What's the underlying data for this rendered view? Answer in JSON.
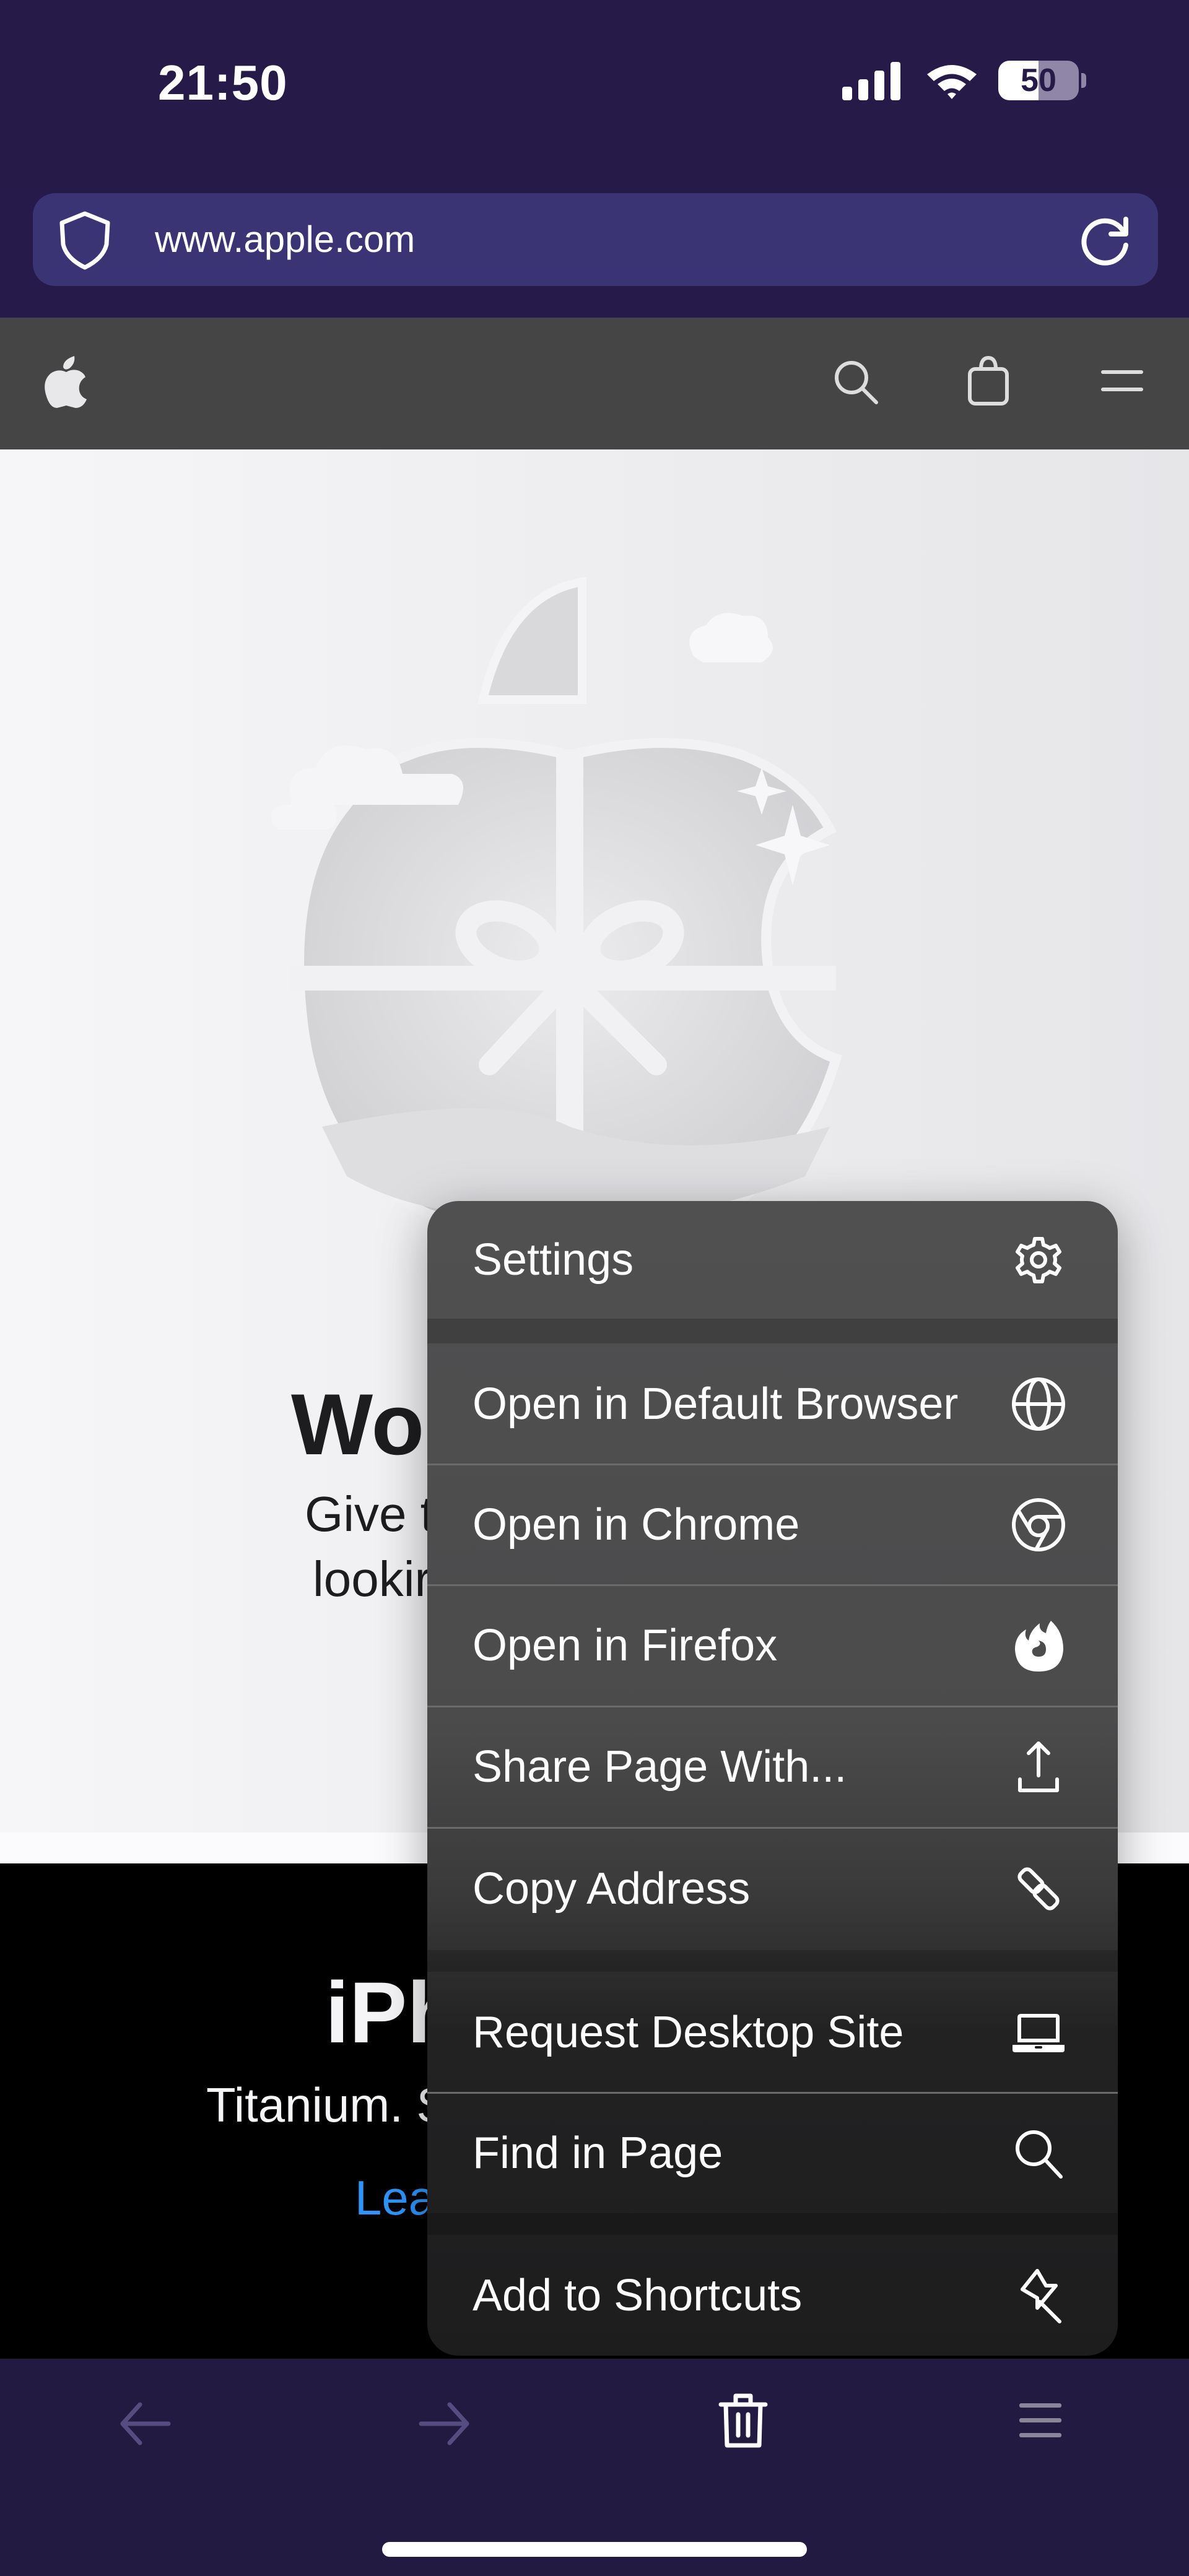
{
  "status_bar": {
    "time": "21:50",
    "battery_percent": "50",
    "signal_icon": "cellular-signal-icon",
    "wifi_icon": "wifi-icon"
  },
  "address_bar": {
    "url": "www.apple.com",
    "left_icon": "shield-icon",
    "right_icon": "reload-icon"
  },
  "site_nav": {
    "logo": "apple-logo-icon",
    "icons": [
      "search-icon",
      "bag-icon",
      "menu-icon"
    ]
  },
  "page": {
    "hero_title_visible": "Wo",
    "hero_subtitle_line1_visible": "Give t",
    "hero_subtitle_line2_visible": "lookir",
    "promo_title_visible": "iPh",
    "promo_subtitle_visible": "Titanium. S",
    "promo_link_visible": "Lea",
    "link_color": "#2997ff"
  },
  "menu": {
    "items": [
      {
        "label": "Settings",
        "icon": "gear-icon"
      },
      {
        "label": "Open in Default Browser",
        "icon": "globe-icon"
      },
      {
        "label": "Open in Chrome",
        "icon": "chrome-icon"
      },
      {
        "label": "Open in Firefox",
        "icon": "firefox-icon"
      },
      {
        "label": "Share Page With...",
        "icon": "share-icon"
      },
      {
        "label": "Copy Address",
        "icon": "link-icon"
      },
      {
        "label": "Request Desktop Site",
        "icon": "laptop-icon"
      },
      {
        "label": "Find in Page",
        "icon": "search-icon"
      },
      {
        "label": "Add to Shortcuts",
        "icon": "pin-icon"
      }
    ]
  },
  "toolbar": {
    "buttons": [
      {
        "name": "back",
        "icon": "arrow-left-icon",
        "enabled": false
      },
      {
        "name": "forward",
        "icon": "arrow-right-icon",
        "enabled": false
      },
      {
        "name": "erase",
        "icon": "trash-icon",
        "enabled": true
      },
      {
        "name": "menu",
        "icon": "hamburger-icon",
        "enabled": true
      }
    ]
  },
  "colors": {
    "status_bg": "#261a49",
    "urlbar_bg": "#3a3374",
    "site_nav_bg": "#454545",
    "menu_bg": "#505051",
    "toolbar_bg": "#231a42"
  }
}
